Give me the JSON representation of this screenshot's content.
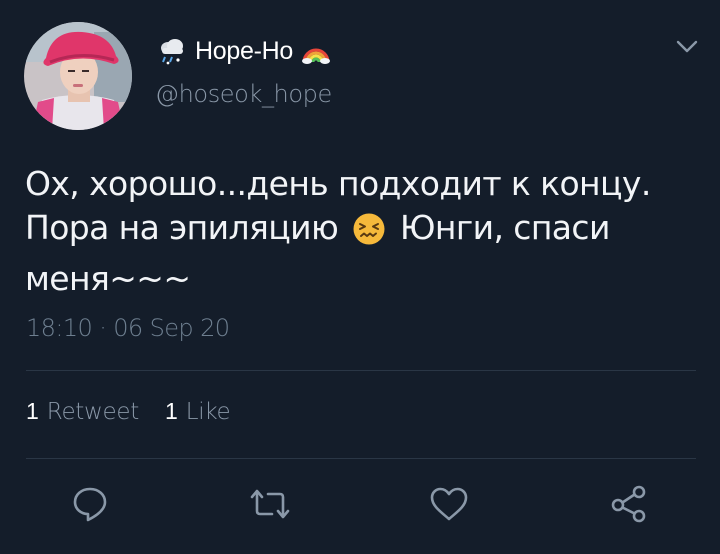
{
  "tweet": {
    "display_name": "Hope-Ho",
    "handle": "@hoseok_hope",
    "text_lines": [
      "Ох, хорошо...день подходит к концу.",
      "Пора на эпиляцию",
      "Юнги, спаси",
      "меня~~~"
    ],
    "timestamp": "18:10 · 06 Sep 20",
    "retweet_count": "1",
    "retweet_label": "Retweet",
    "like_count": "1",
    "like_label": "Like"
  },
  "icons": {
    "name_prefix": "cloud-rain-snow-icon",
    "name_suffix": "rainbow-icon",
    "inline_emoji": "confounded-face-icon",
    "menu": "chevron-down-icon",
    "actions": [
      "reply-icon",
      "retweet-icon",
      "like-icon",
      "share-icon"
    ]
  },
  "colors": {
    "background": "#141d2a",
    "secondary_text": "#8a98a8",
    "icon": "#8a98a8"
  }
}
